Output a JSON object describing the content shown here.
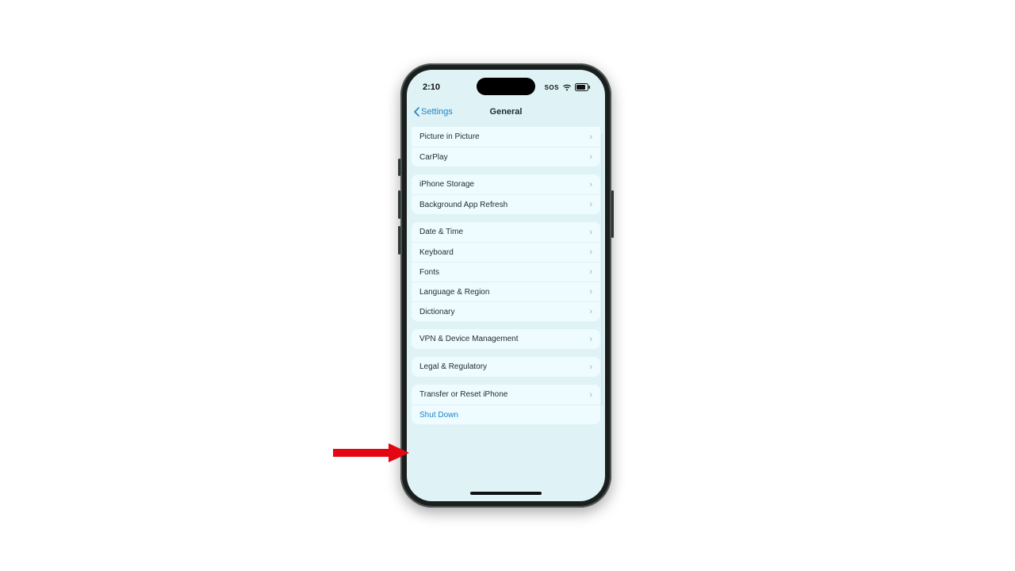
{
  "status": {
    "time": "2:10",
    "sos": "SOS"
  },
  "nav": {
    "back_label": "Settings",
    "title": "General"
  },
  "groups": [
    {
      "partialTop": true,
      "rows": [
        {
          "label": "Picture in Picture",
          "chevron": true
        },
        {
          "label": "CarPlay",
          "chevron": true
        }
      ]
    },
    {
      "rows": [
        {
          "label": "iPhone Storage",
          "chevron": true
        },
        {
          "label": "Background App Refresh",
          "chevron": true
        }
      ]
    },
    {
      "rows": [
        {
          "label": "Date & Time",
          "chevron": true
        },
        {
          "label": "Keyboard",
          "chevron": true
        },
        {
          "label": "Fonts",
          "chevron": true
        },
        {
          "label": "Language & Region",
          "chevron": true
        },
        {
          "label": "Dictionary",
          "chevron": true
        }
      ]
    },
    {
      "rows": [
        {
          "label": "VPN & Device Management",
          "chevron": true
        }
      ]
    },
    {
      "rows": [
        {
          "label": "Legal & Regulatory",
          "chevron": true
        }
      ]
    },
    {
      "rows": [
        {
          "label": "Transfer or Reset iPhone",
          "chevron": true
        },
        {
          "label": "Shut Down",
          "chevron": false,
          "link": true
        }
      ]
    }
  ],
  "annotation": {
    "arrow_color": "#e30613",
    "points_to": "Shut Down"
  }
}
